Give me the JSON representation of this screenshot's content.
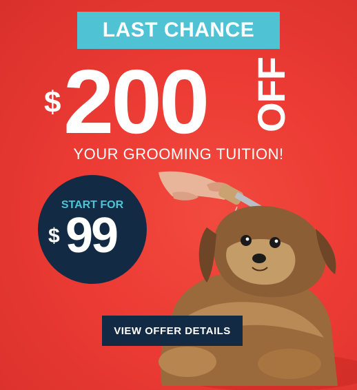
{
  "banner": {
    "label": "LAST CHANCE"
  },
  "headline": {
    "currency": "$",
    "amount": "200",
    "suffix": "OFF"
  },
  "subtitle": "YOUR GROOMING TUITION!",
  "price_badge": {
    "label": "START FOR",
    "currency": "$",
    "amount": "99"
  },
  "cta": {
    "label": "VIEW OFFER DETAILS"
  },
  "colors": {
    "background": "#ec3b34",
    "banner": "#4fc3d3",
    "navy": "#132a44",
    "accent_text": "#4fc3d3"
  }
}
